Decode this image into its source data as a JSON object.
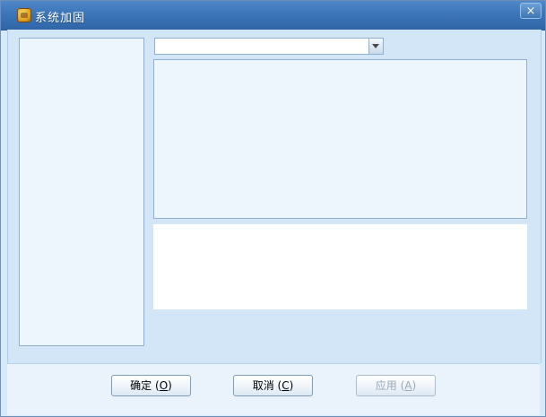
{
  "window": {
    "title": "系统加固",
    "close_label": "×"
  },
  "combo": {
    "value": ""
  },
  "buttons": {
    "ok": {
      "label": "确定",
      "accel": "O"
    },
    "cancel": {
      "label": "取消",
      "accel": "C"
    },
    "apply": {
      "label": "应用",
      "accel": "A"
    }
  }
}
